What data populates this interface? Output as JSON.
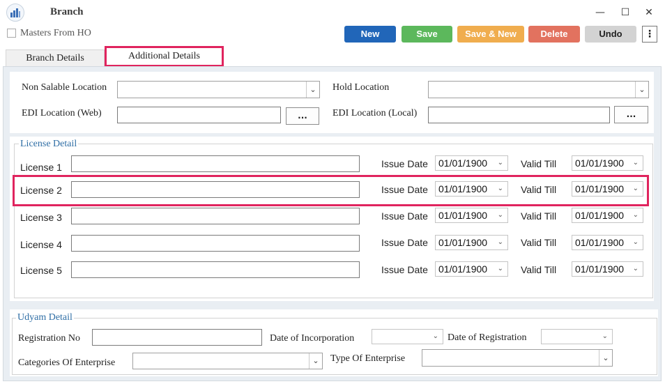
{
  "window": {
    "title": "Branch",
    "minimize": "—",
    "maximize": "☐",
    "close": "✕"
  },
  "toolbar": {
    "masters_from_ho": "Masters From HO",
    "new": "New",
    "save": "Save",
    "save_new": "Save & New",
    "delete": "Delete",
    "undo": "Undo",
    "more": "⋮",
    "colors": {
      "new": "#2166b9",
      "save": "#5cb85c",
      "save_new": "#f0ad4e",
      "delete": "#e2725f",
      "undo": "#d3d3d3"
    }
  },
  "tabs": {
    "branch_details": "Branch Details",
    "additional_details": "Additional Details"
  },
  "locations": {
    "non_salable_label": "Non Salable Location",
    "hold_label": "Hold Location",
    "edi_web_label": "EDI Location (Web)",
    "edi_local_label": "EDI Location (Local)",
    "browse": "..."
  },
  "license": {
    "group_title": "License Detail",
    "issue_label": "Issue Date",
    "valid_label": "Valid Till",
    "rows": [
      {
        "label": "License 1",
        "issue": "01/01/1900",
        "valid": "01/01/1900"
      },
      {
        "label": "License 2",
        "issue": "01/01/1900",
        "valid": "01/01/1900"
      },
      {
        "label": "License 3",
        "issue": "01/01/1900",
        "valid": "01/01/1900"
      },
      {
        "label": "License 4",
        "issue": "01/01/1900",
        "valid": "01/01/1900"
      },
      {
        "label": "License 5",
        "issue": "01/01/1900",
        "valid": "01/01/1900"
      }
    ]
  },
  "udyam": {
    "group_title": "Udyam Detail",
    "registration_no": "Registration No",
    "date_of_incorporation": "Date of Incorporation",
    "date_of_registration": "Date of Registration",
    "categories": "Categories Of Enterprise",
    "type": "Type Of Enterprise"
  },
  "highlight_color": "#e0245e"
}
